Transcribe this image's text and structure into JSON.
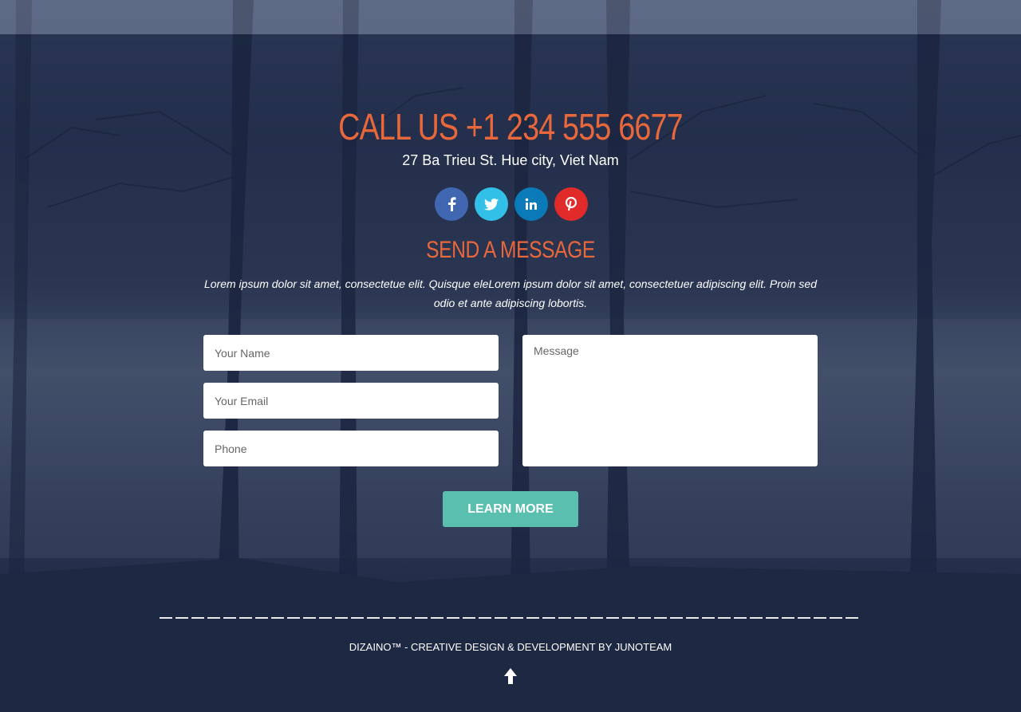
{
  "contact": {
    "call_title": "CALL US +1 234 555 6677",
    "address": "27 Ba Trieu St. Hue city, Viet Nam"
  },
  "socials": [
    {
      "name": "facebook",
      "glyph": "f",
      "color": "#4267b2"
    },
    {
      "name": "twitter",
      "glyph": "t",
      "color": "#33c0e8"
    },
    {
      "name": "linkedin",
      "glyph": "in",
      "color": "#0a7ab8"
    },
    {
      "name": "pinterest",
      "glyph": "p",
      "color": "#e12a2a"
    }
  ],
  "message": {
    "title": "SEND A MESSAGE",
    "description": "Lorem ipsum dolor sit amet, consectetue elit. Quisque eleLorem ipsum dolor sit amet, consectetuer adipiscing elit. Proin sed odio et ante adipiscing lobortis."
  },
  "form": {
    "name_placeholder": "Your Name",
    "email_placeholder": "Your Email",
    "phone_placeholder": "Phone",
    "message_placeholder": "Message",
    "submit_label": "LEARN MORE"
  },
  "footer": {
    "credit": "DIZAINO™ - CREATIVE DESIGN & DEVELOPMENT BY JUNOTEAM"
  },
  "colors": {
    "accent": "#e8673b",
    "button": "#5bbfb0"
  }
}
